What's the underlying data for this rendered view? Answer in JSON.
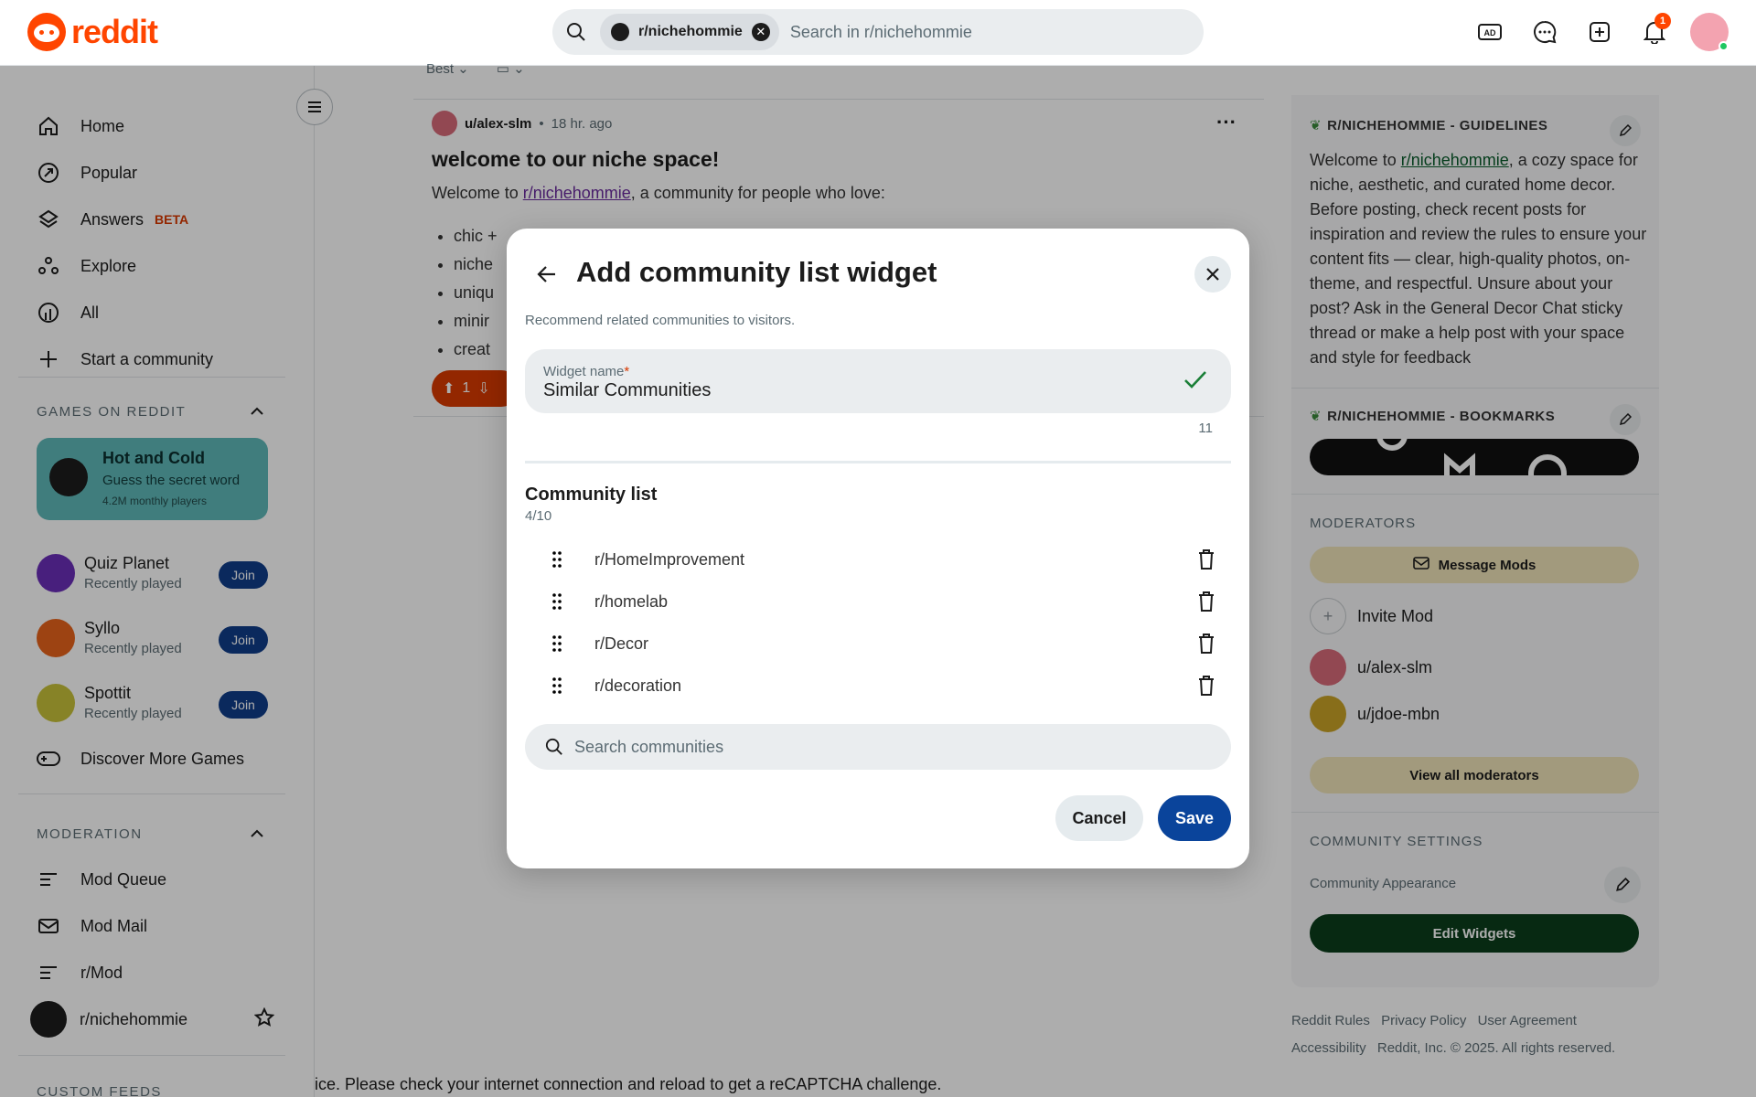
{
  "header": {
    "logo_text": "reddit",
    "search_chip": "r/nichehommie",
    "search_placeholder": "Search in r/nichehommie",
    "notification_count": "1",
    "icons": [
      "advertise-icon",
      "chat-icon",
      "create-post-icon",
      "notification-bell-icon",
      "user-avatar"
    ]
  },
  "sidebar": {
    "nav": [
      {
        "label": "Home",
        "icon": "home-icon"
      },
      {
        "label": "Popular",
        "icon": "popular-icon"
      },
      {
        "label": "Answers",
        "badge": "BETA",
        "icon": "answers-icon"
      },
      {
        "label": "Explore",
        "icon": "explore-icon"
      },
      {
        "label": "All",
        "icon": "all-icon"
      },
      {
        "label": "Start a community",
        "icon": "plus-icon"
      }
    ],
    "games_section": "GAMES ON REDDIT",
    "featured_game": {
      "title": "Hot and Cold",
      "subtitle": "Guess the secret word",
      "players": "4.2M monthly players"
    },
    "games": [
      {
        "name": "Quiz Planet",
        "status": "Recently played",
        "action": "Join",
        "color": "#6b2fb8"
      },
      {
        "name": "Syllo",
        "status": "Recently played",
        "action": "Join",
        "color": "#e8641b"
      },
      {
        "name": "Spottit",
        "status": "Recently played",
        "action": "Join",
        "color": "#c8c23a"
      }
    ],
    "discover_games": "Discover More Games",
    "moderation_section": "MODERATION",
    "mod_items": [
      {
        "label": "Mod Queue",
        "icon": "mod-queue-icon"
      },
      {
        "label": "Mod Mail",
        "icon": "mod-mail-icon"
      },
      {
        "label": "r/Mod",
        "icon": "mod-list-icon"
      }
    ],
    "community": "r/nichehommie",
    "custom_feeds_section": "CUSTOM FEEDS"
  },
  "main": {
    "sort_label": "Best",
    "post": {
      "author": "u/alex-slm",
      "time": "18 hr. ago",
      "title": "welcome to our niche space!",
      "body_prefix": "Welcome to",
      "body_link": "r/nichehommie",
      "body_suffix": ", a community for people who love:",
      "bullets": [
        "chic +",
        "niche",
        "uniqu",
        "minir",
        "creat"
      ],
      "votes": "1"
    }
  },
  "right_sidebar": {
    "guidelines_title": "R/NICHEHOMMIE - GUIDELINES",
    "guidelines_prefix": "Welcome to",
    "guidelines_link": "r/nichehommie",
    "guidelines_text": ", a cozy space for niche, aesthetic, and curated home decor. Before posting, check recent posts for inspiration and review the rules to ensure your content fits — clear, high-quality photos, on-theme, and respectful. Unsure about your post? Ask in the General Decor Chat sticky thread or make a help post with your space and style for feedback",
    "bookmarks_title": "R/NICHEHOMMIE - BOOKMARKS",
    "moderators_title": "MODERATORS",
    "message_mods": "Message Mods",
    "invite_mod": "Invite Mod",
    "moderators": [
      {
        "name": "u/alex-slm",
        "color": "#d86a7a"
      },
      {
        "name": "u/jdoe-mbn",
        "color": "#c9a227"
      }
    ],
    "view_all_moderators": "View all moderators",
    "community_settings_title": "COMMUNITY SETTINGS",
    "community_appearance": "Community Appearance",
    "edit_widgets": "Edit Widgets"
  },
  "footer": {
    "links": [
      "Reddit Rules",
      "Privacy Policy",
      "User Agreement",
      "Accessibility"
    ],
    "copyright": "Reddit, Inc. © 2025. All rights reserved."
  },
  "recaptcha_message": "ice. Please check your internet connection and reload to get a reCAPTCHA challenge.",
  "modal": {
    "title": "Add community list widget",
    "description": "Recommend related communities to visitors.",
    "widget_name_label": "Widget name",
    "widget_name_required": "*",
    "widget_name_value": "Similar Communities",
    "char_count": "11",
    "community_list_title": "Community list",
    "community_list_count": "4/10",
    "communities": [
      "r/HomeImprovement",
      "r/homelab",
      "r/Decor",
      "r/decoration"
    ],
    "search_placeholder": "Search communities",
    "cancel": "Cancel",
    "save": "Save"
  }
}
